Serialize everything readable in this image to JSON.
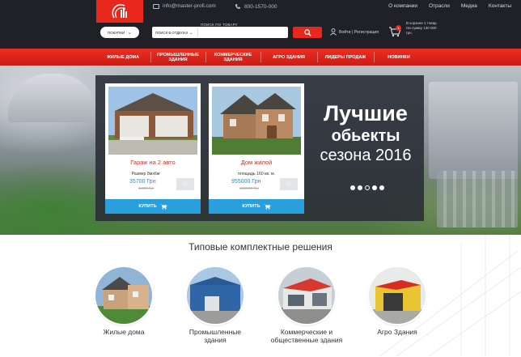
{
  "header": {
    "email": "info@master-profi.com",
    "phone": "800-1570-000",
    "top_nav": [
      "О компании",
      "Отрасли",
      "Медиа",
      "Контакты"
    ],
    "menu_button": "ПОКУПКИ",
    "search_label": "ПОИСК ПО ТОВАРУ",
    "search_category": "ПОИСК В ОТДЕЛАХ",
    "search_placeholder": "",
    "auth": "Войти | Регистрация",
    "cart_count": "1",
    "cart_text": "В корзине 1 товар На сумму 130 000 грн."
  },
  "main_nav": [
    {
      "label": "Жилые дома"
    },
    {
      "label": "Промышленные здания"
    },
    {
      "label": "Коммерческие здания"
    },
    {
      "label": "Агро здания"
    },
    {
      "label": "Лидеры продаж"
    },
    {
      "label": "Новинки"
    }
  ],
  "hero": {
    "line1": "Лучшие",
    "line2": "обьекты",
    "line3": "сезона 2016",
    "dots_total": 5,
    "dots_active": 3
  },
  "products": [
    {
      "title": "Гараж на 2 авто",
      "subtitle": "Размер 8мх6м",
      "price": "35700 Грн",
      "old_price": "45000 Грн",
      "buy": "КУПИТЬ"
    },
    {
      "title": "Дом жилой",
      "subtitle": "площадь 160 кв. м.",
      "price": "955000 Грн",
      "old_price": "1200000 Грн",
      "buy": "КУПИТЬ"
    }
  ],
  "solutions": {
    "title": "Типовые комплектные решения",
    "items": [
      {
        "label": "Жилые дома"
      },
      {
        "label": "Промышленные здания"
      },
      {
        "label": "Коммерческие и общественные здания"
      },
      {
        "label": "Агро Здания"
      }
    ]
  },
  "colors": {
    "accent": "#e8271d",
    "dark": "#1f2126",
    "blue": "#29a0dc"
  }
}
